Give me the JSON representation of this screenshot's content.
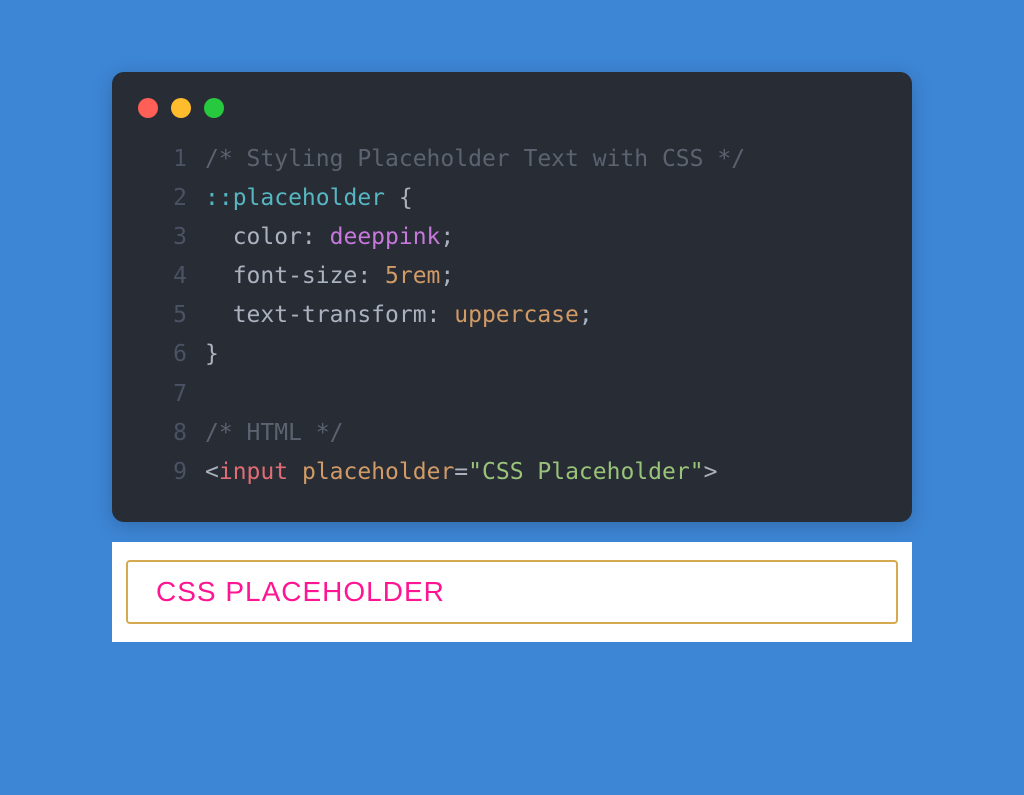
{
  "code": {
    "lines": [
      {
        "num": "1",
        "tokens": [
          {
            "cls": "tok-comment",
            "text": "/* Styling Placeholder Text with CSS */"
          }
        ]
      },
      {
        "num": "2",
        "tokens": [
          {
            "cls": "tok-selector",
            "text": "::placeholder"
          },
          {
            "cls": "tok-brace",
            "text": " {"
          }
        ]
      },
      {
        "num": "3",
        "tokens": [
          {
            "cls": "tok-prop",
            "text": "  color: "
          },
          {
            "cls": "tok-value-name",
            "text": "deeppink"
          },
          {
            "cls": "tok-prop",
            "text": ";"
          }
        ]
      },
      {
        "num": "4",
        "tokens": [
          {
            "cls": "tok-prop",
            "text": "  font-size: "
          },
          {
            "cls": "tok-value-num",
            "text": "5rem"
          },
          {
            "cls": "tok-prop",
            "text": ";"
          }
        ]
      },
      {
        "num": "5",
        "tokens": [
          {
            "cls": "tok-prop",
            "text": "  text-transform: "
          },
          {
            "cls": "tok-value-num",
            "text": "uppercase"
          },
          {
            "cls": "tok-prop",
            "text": ";"
          }
        ]
      },
      {
        "num": "6",
        "tokens": [
          {
            "cls": "tok-brace",
            "text": "}"
          }
        ]
      },
      {
        "num": "7",
        "tokens": []
      },
      {
        "num": "8",
        "tokens": [
          {
            "cls": "tok-comment",
            "text": "/* HTML */"
          }
        ]
      },
      {
        "num": "9",
        "tokens": [
          {
            "cls": "tok-angle",
            "text": "<"
          },
          {
            "cls": "tok-tag",
            "text": "input"
          },
          {
            "cls": "tok-angle",
            "text": " "
          },
          {
            "cls": "tok-attr",
            "text": "placeholder"
          },
          {
            "cls": "tok-eq",
            "text": "="
          },
          {
            "cls": "tok-string",
            "text": "\"CSS Placeholder\""
          },
          {
            "cls": "tok-angle",
            "text": ">"
          }
        ]
      }
    ]
  },
  "demo": {
    "placeholder": "CSS Placeholder"
  }
}
